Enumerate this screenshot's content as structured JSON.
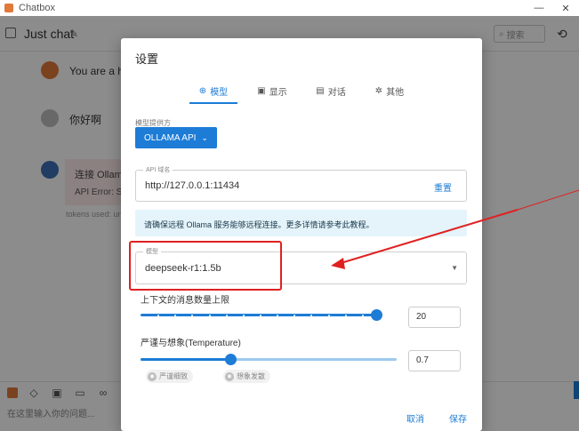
{
  "window": {
    "title": "Chatbox",
    "minimize": "—",
    "close": "✕"
  },
  "header": {
    "chat_title": "Just chat",
    "search_placeholder": "搜索"
  },
  "messages": [
    {
      "role": "system",
      "text": "You are a hel"
    },
    {
      "role": "user",
      "text": "你好啊"
    },
    {
      "role": "assistant",
      "error_title": "连接 Ollama A",
      "error_detail": "API Error: Sta",
      "tokens": "tokens used: unk"
    }
  ],
  "input": {
    "placeholder": "在这里输入你的问题..."
  },
  "dialog": {
    "title": "设置",
    "tabs": [
      {
        "label": "模型",
        "icon": "model-icon",
        "active": true
      },
      {
        "label": "显示",
        "icon": "display-icon",
        "active": false
      },
      {
        "label": "对话",
        "icon": "chat-icon",
        "active": false
      },
      {
        "label": "其他",
        "icon": "gear-icon",
        "active": false
      }
    ],
    "provider": {
      "label": "模型提供方",
      "value": "OLLAMA API"
    },
    "api_host": {
      "legend": "API 域名",
      "value": "http://127.0.0.1:11434",
      "reset_label": "重置"
    },
    "info": "请确保远程 Ollama 服务能够远程连接。更多详情请参考此教程。",
    "model": {
      "legend": "模型",
      "value": "deepseek-r1:1.5b"
    },
    "context_limit": {
      "label": "上下文的消息数量上限",
      "value": "20",
      "slider_fraction": 0.99
    },
    "temperature": {
      "label": "严谨与想象(Temperature)",
      "value": "0.7",
      "slider_fraction": 0.35
    },
    "chips": {
      "strict": "严谨细致",
      "creative": "想象发散"
    },
    "actions": {
      "cancel": "取消",
      "save": "保存"
    }
  },
  "colors": {
    "accent": "#1d7cd6",
    "annotation": "#e02020",
    "info_bg": "#e5f4fb"
  }
}
